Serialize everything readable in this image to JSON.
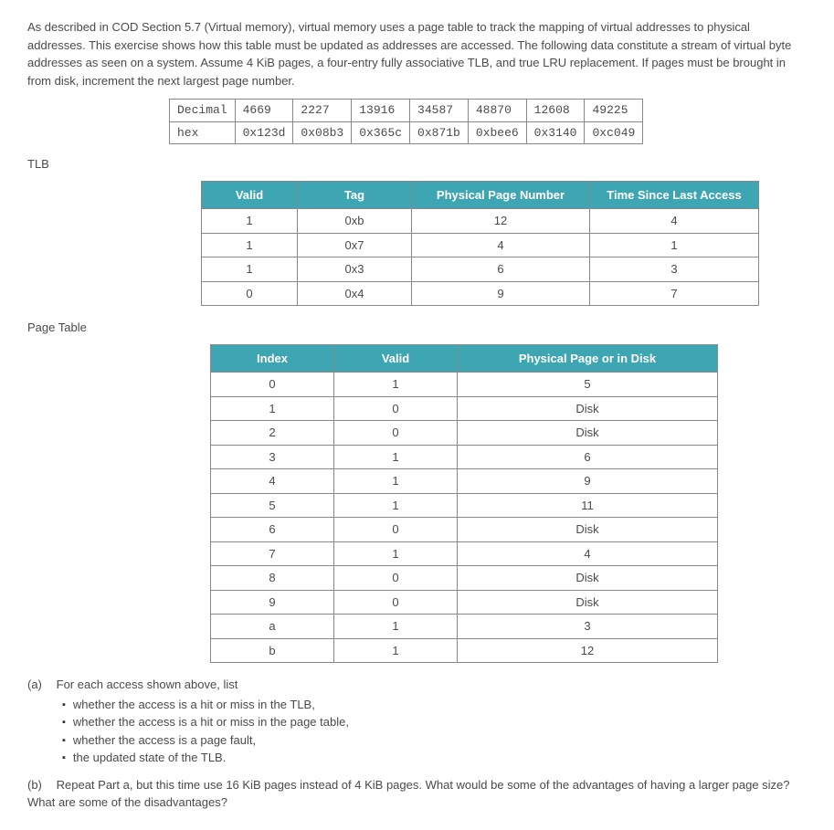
{
  "intro": "As described in COD Section 5.7 (Virtual memory), virtual memory uses a page table to track the mapping of virtual addresses to physical addresses. This exercise shows how this table must be updated as addresses are accessed. The following data constitute a stream of virtual byte addresses as seen on a system. Assume 4 KiB pages, a four-entry fully associative TLB, and true LRU replacement. If pages must be brought in from disk, increment the next largest page number.",
  "addr": {
    "row1_label": "Decimal",
    "row2_label": "hex",
    "dec": [
      "4669",
      "2227",
      "13916",
      "34587",
      "48870",
      "12608",
      "49225"
    ],
    "hex": [
      "0x123d",
      "0x08b3",
      "0x365c",
      "0x871b",
      "0xbee6",
      "0x3140",
      "0xc049"
    ]
  },
  "tlb_label": "TLB",
  "tlb_headers": {
    "valid": "Valid",
    "tag": "Tag",
    "ppn": "Physical Page Number",
    "tsla": "Time Since Last Access"
  },
  "tlb_rows": [
    {
      "valid": "1",
      "tag": "0xb",
      "ppn": "12",
      "tsla": "4"
    },
    {
      "valid": "1",
      "tag": "0x7",
      "ppn": "4",
      "tsla": "1"
    },
    {
      "valid": "1",
      "tag": "0x3",
      "ppn": "6",
      "tsla": "3"
    },
    {
      "valid": "0",
      "tag": "0x4",
      "ppn": "9",
      "tsla": "7"
    }
  ],
  "pt_label": "Page Table",
  "pt_headers": {
    "index": "Index",
    "valid": "Valid",
    "pp": "Physical Page or in Disk"
  },
  "pt_rows": [
    {
      "index": "0",
      "valid": "1",
      "pp": "5"
    },
    {
      "index": "1",
      "valid": "0",
      "pp": "Disk"
    },
    {
      "index": "2",
      "valid": "0",
      "pp": "Disk"
    },
    {
      "index": "3",
      "valid": "1",
      "pp": "6"
    },
    {
      "index": "4",
      "valid": "1",
      "pp": "9"
    },
    {
      "index": "5",
      "valid": "1",
      "pp": "11"
    },
    {
      "index": "6",
      "valid": "0",
      "pp": "Disk"
    },
    {
      "index": "7",
      "valid": "1",
      "pp": "4"
    },
    {
      "index": "8",
      "valid": "0",
      "pp": "Disk"
    },
    {
      "index": "9",
      "valid": "0",
      "pp": "Disk"
    },
    {
      "index": "a",
      "valid": "1",
      "pp": "3"
    },
    {
      "index": "b",
      "valid": "1",
      "pp": "12"
    }
  ],
  "qa": {
    "label": "(a)",
    "lead": "For each access shown above, list",
    "items": [
      "whether the access is a hit or miss in the TLB,",
      "whether the access is a hit or miss in the page table,",
      "whether the access is a page fault,",
      "the updated state of the TLB."
    ]
  },
  "qb": {
    "label": "(b)",
    "text": "Repeat Part a, but this time use 16 KiB pages instead of 4 KiB pages. What would be some of the advantages of having a larger page size? What are some of the disadvantages?"
  }
}
